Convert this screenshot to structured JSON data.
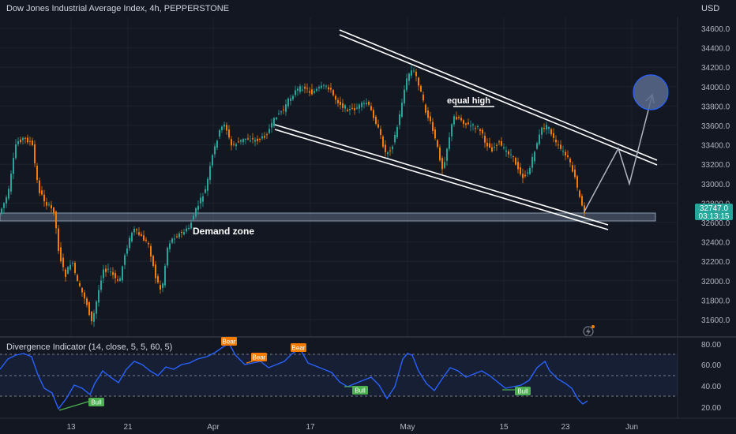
{
  "header": {
    "symbol_title": "Dow Jones Industrial Average Index, 4h, PEPPERSTONE",
    "currency": "USD"
  },
  "price_axis": {
    "ticks": [
      "34600.0",
      "34400.0",
      "34200.0",
      "34000.0",
      "33800.0",
      "33600.0",
      "33400.0",
      "33200.0",
      "33000.0",
      "32800.0",
      "32600.0",
      "32400.0",
      "32200.0",
      "32000.0",
      "31800.0",
      "31600.0"
    ],
    "last_price": "32747.0",
    "countdown": "03:13:15",
    "last_price_color": "#26a69a"
  },
  "annotations": {
    "equal_high": "equal high",
    "demand_zone": "Demand zone"
  },
  "indicator": {
    "title": "Divergence Indicator (14, close, 5, 5, 60, 5)",
    "ticks": [
      "80.00",
      "60.00",
      "40.00",
      "20.00"
    ],
    "signals": [
      {
        "label": "Bull",
        "color": "#4caf50"
      },
      {
        "label": "Bear",
        "color": "#f57c00"
      },
      {
        "label": "Bear",
        "color": "#f57c00"
      },
      {
        "label": "Bear",
        "color": "#f57c00"
      },
      {
        "label": "Bull",
        "color": "#4caf50"
      },
      {
        "label": "Bull",
        "color": "#4caf50"
      }
    ],
    "line_color": "#2962ff"
  },
  "time_axis": {
    "labels": [
      "13",
      "21",
      "Apr",
      "17",
      "May",
      "15",
      "23",
      "Jun"
    ]
  },
  "colors": {
    "up_candle": "#26a69a",
    "down_candle": "#f57c00",
    "background": "#131722"
  },
  "icons": {
    "time_zone_button": "lightning-clock-icon"
  }
}
